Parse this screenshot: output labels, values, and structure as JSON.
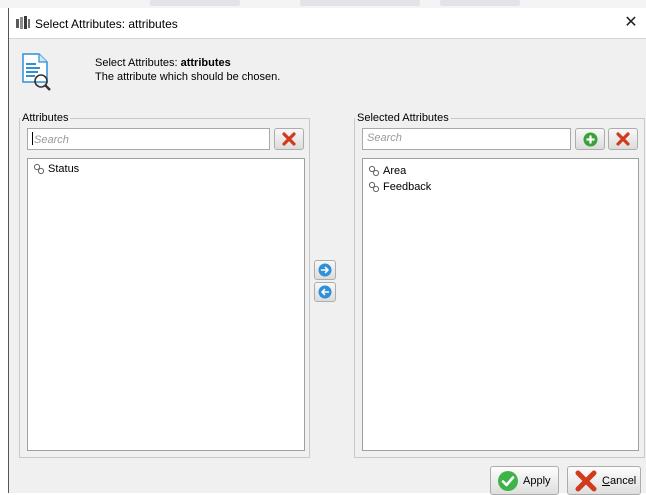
{
  "window": {
    "title": "Select Attributes: attributes"
  },
  "header": {
    "title_prefix": "Select Attributes: ",
    "title_bold": "attributes",
    "description": "The attribute which should be chosen."
  },
  "left_panel": {
    "legend": "Attributes",
    "search_placeholder": "Search",
    "items": [
      {
        "label": "Status"
      }
    ]
  },
  "right_panel": {
    "legend": "Selected Attributes",
    "search_placeholder": "Search",
    "items": [
      {
        "label": "Area"
      },
      {
        "label": "Feedback"
      }
    ]
  },
  "buttons": {
    "apply_label": "Apply",
    "cancel_label": "Cancel"
  },
  "colors": {
    "accent_blue": "#2f8fd8",
    "add_green": "#3aa23a",
    "remove_red": "#d23a1e",
    "apply_green": "#3fb34a"
  },
  "icons": {
    "attribute": "attribute-icon",
    "clear": "clear-x-icon",
    "add": "add-plus-icon",
    "move_right": "arrow-right-icon",
    "move_left": "arrow-left-icon"
  }
}
